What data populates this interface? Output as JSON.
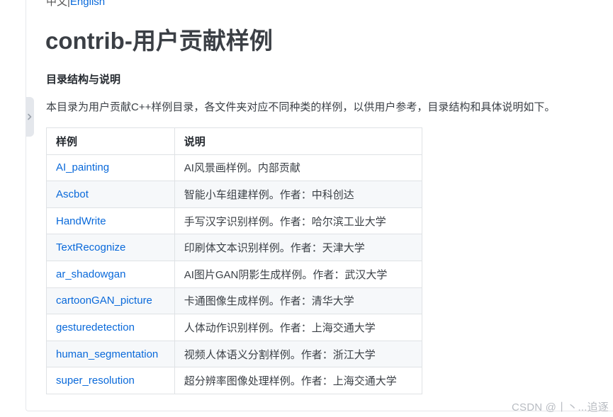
{
  "lang": {
    "chinese": "中文",
    "separator": "|",
    "english": "English"
  },
  "title": "contrib-用户贡献样例",
  "section_heading": "目录结构与说明",
  "intro": "本目录为用户贡献C++样例目录，各文件夹对应不同种类的样例，以供用户参考，目录结构和具体说明如下。",
  "table": {
    "headers": [
      "样例",
      "说明"
    ],
    "rows": [
      {
        "name": "AI_painting",
        "desc": "AI风景画样例。内部贡献"
      },
      {
        "name": "Ascbot",
        "desc": "智能小车组建样例。作者：中科创达"
      },
      {
        "name": "HandWrite",
        "desc": "手写汉字识别样例。作者：哈尔滨工业大学"
      },
      {
        "name": "TextRecognize",
        "desc": "印刷体文本识别样例。作者：天津大学"
      },
      {
        "name": "ar_shadowgan",
        "desc": "AI图片GAN阴影生成样例。作者：武汉大学"
      },
      {
        "name": "cartoonGAN_picture",
        "desc": "卡通图像生成样例。作者：清华大学"
      },
      {
        "name": "gesturedetection",
        "desc": "人体动作识别样例。作者：上海交通大学"
      },
      {
        "name": "human_segmentation",
        "desc": "视频人体语义分割样例。作者：浙江大学"
      },
      {
        "name": "super_resolution",
        "desc": "超分辨率图像处理样例。作者：上海交通大学"
      }
    ]
  },
  "watermark": "CSDN @丨丶...追逐",
  "icons": {
    "side_toggle": "chevron-right-icon"
  },
  "colors": {
    "link": "#0969da",
    "title": "#3b3f45",
    "stripe": "#f6f8fa",
    "border": "#dfe2e5"
  }
}
